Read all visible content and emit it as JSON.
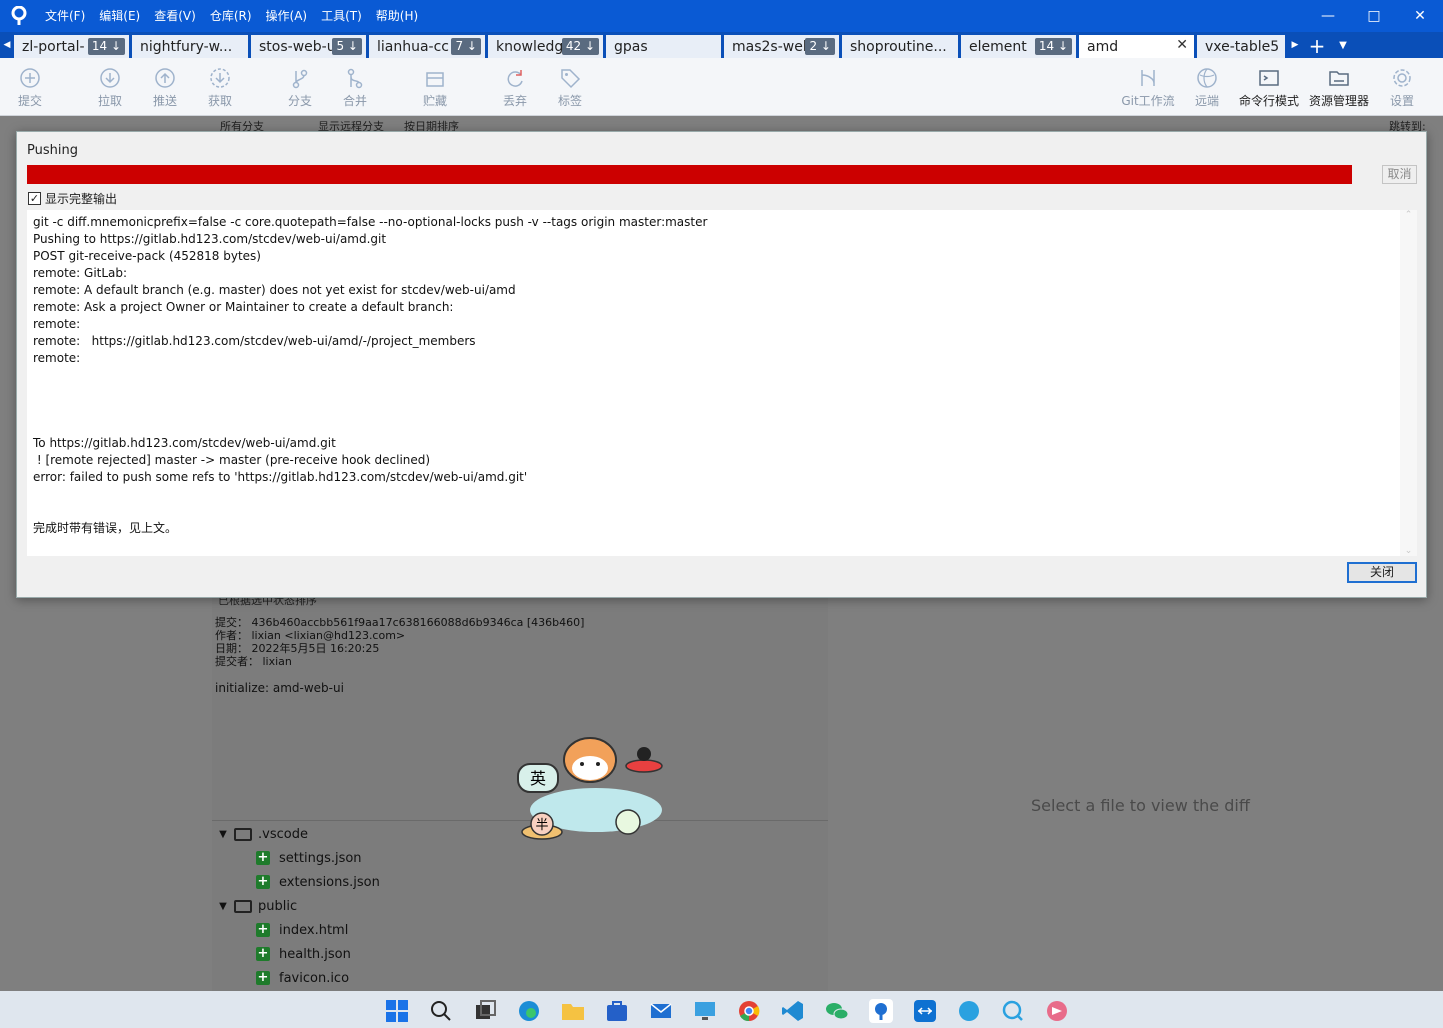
{
  "window": {
    "menu": [
      "文件(F)",
      "编辑(E)",
      "查看(V)",
      "仓库(R)",
      "操作(A)",
      "工具(T)",
      "帮助(H)"
    ],
    "controls": [
      "minimize",
      "maximize",
      "close"
    ]
  },
  "tabs": [
    {
      "label": "zl-portal-",
      "badge": "14 ↓"
    },
    {
      "label": "nightfury-w...",
      "badge": ""
    },
    {
      "label": "stos-web-u",
      "badge": "5 ↓"
    },
    {
      "label": "lianhua-cc",
      "badge": "7 ↓"
    },
    {
      "label": "knowledg",
      "badge": "42 ↓"
    },
    {
      "label": "gpas",
      "badge": ""
    },
    {
      "label": "mas2s-web",
      "badge": "2 ↓"
    },
    {
      "label": "shoproutine...",
      "badge": ""
    },
    {
      "label": "element",
      "badge": "14 ↓"
    },
    {
      "label": "amd",
      "badge": "",
      "active": true
    },
    {
      "label": "vxe-table5",
      "badge": ""
    }
  ],
  "toolbar": {
    "commit": "提交",
    "pull": "拉取",
    "push": "推送",
    "fetch": "获取",
    "branch": "分支",
    "merge": "合并",
    "stash": "贮藏",
    "discard": "丢弃",
    "tag": "标签",
    "gitflow": "Git工作流",
    "remote": "远端",
    "terminal": "命令行模式",
    "explorer": "资源管理器",
    "settings": "设置"
  },
  "dialog": {
    "title": "Pushing",
    "progress": 1.0,
    "cancel": "取消",
    "show_full_output": "显示完整输出",
    "show_full_output_checked": true,
    "close": "关闭",
    "output_lines": [
      "git -c diff.mnemonicprefix=false -c core.quotepath=false --no-optional-locks push -v --tags origin master:master",
      "Pushing to https://gitlab.hd123.com/stcdev/web-ui/amd.git",
      "POST git-receive-pack (452818 bytes)",
      "remote: GitLab:",
      "remote: A default branch (e.g. master) does not yet exist for stcdev/web-ui/amd",
      "remote: Ask a project Owner or Maintainer to create a default branch:",
      "remote:",
      "remote:   https://gitlab.hd123.com/stcdev/web-ui/amd/-/project_members",
      "remote:",
      "",
      "",
      "",
      "",
      "To https://gitlab.hd123.com/stcdev/web-ui/amd.git",
      " ! [remote rejected] master -> master (pre-receive hook declined)",
      "error: failed to push some refs to 'https://gitlab.hd123.com/stcdev/web-ui/amd.git'",
      "",
      "",
      "完成时带有错误，见上文。"
    ]
  },
  "background": {
    "top_strip": [
      "所有分支",
      "显示远程分支",
      "按日期排序",
      "跳转到:"
    ],
    "sort_label": "已根据选中状态排序",
    "commit": {
      "hash": "提交： 436b460accbb561f9aa17c638166088d6b9346ca [436b460]",
      "author": "作者： lixian <lixian@hd123.com>",
      "date": "日期： 2022年5月5日 16:20:25",
      "committer": "提交者： lixian",
      "message": "initialize: amd-web-ui"
    },
    "tree": [
      {
        "type": "folder",
        "name": ".vscode"
      },
      {
        "type": "file",
        "name": "settings.json"
      },
      {
        "type": "file",
        "name": "extensions.json"
      },
      {
        "type": "folder",
        "name": "public"
      },
      {
        "type": "file",
        "name": "index.html"
      },
      {
        "type": "file",
        "name": "health.json"
      },
      {
        "type": "file",
        "name": "favicon.ico"
      }
    ],
    "diff_hint": "Select a file to view the diff",
    "sticker_text": [
      "英",
      "半"
    ]
  },
  "colors": {
    "titlebar": "#0a5ad4",
    "progress_fill": "#cc0000",
    "close_border": "#1f6fd1"
  }
}
